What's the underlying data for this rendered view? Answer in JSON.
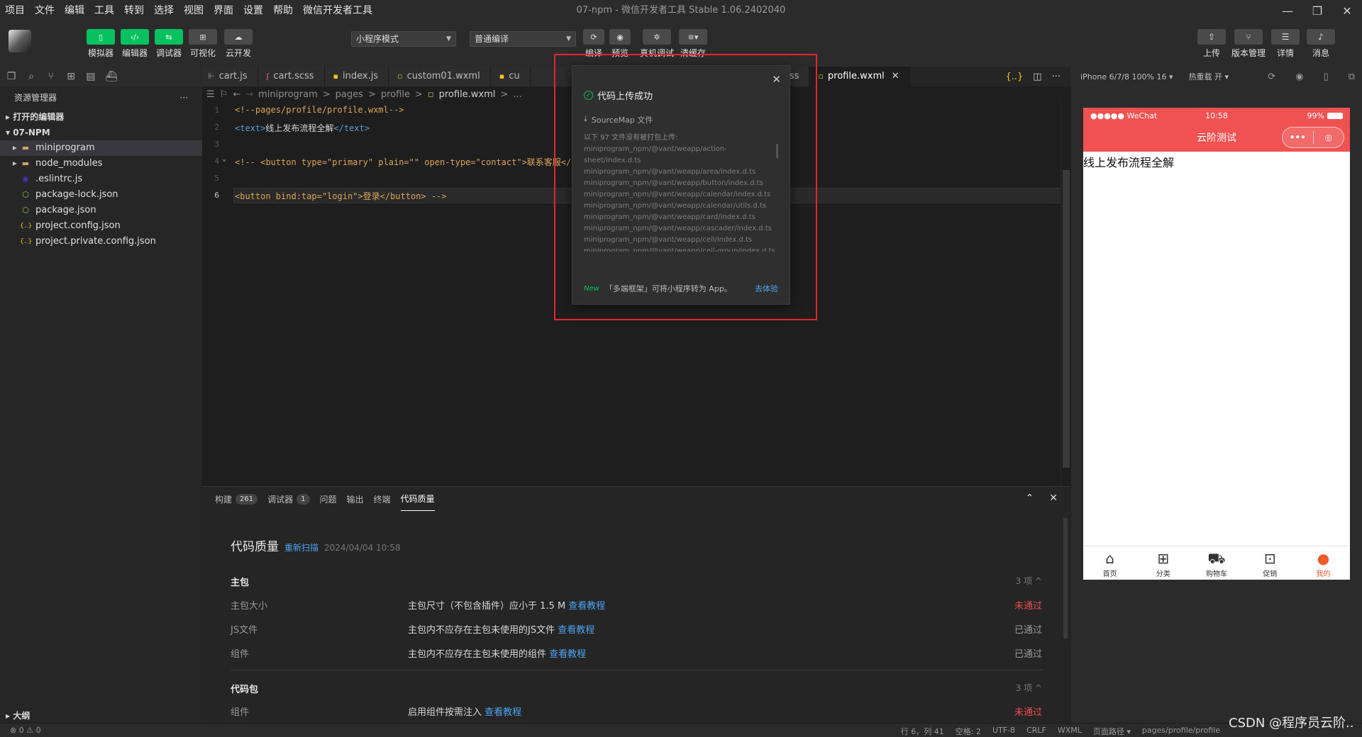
{
  "menu": [
    "项目",
    "文件",
    "编辑",
    "工具",
    "转到",
    "选择",
    "视图",
    "界面",
    "设置",
    "帮助",
    "微信开发者工具"
  ],
  "window_title": "07-npm - 微信开发者工具 Stable 1.06.2402040",
  "toolbar": {
    "simulator": "模拟器",
    "editor": "编辑器",
    "debugger": "调试器",
    "visual": "可视化",
    "cloud": "云开发",
    "mode_select": "小程序模式",
    "compile_select": "普通编译",
    "compile": "编译",
    "preview": "预览",
    "real_debug": "真机调试",
    "clear_cache": "清缓存",
    "upload": "上传",
    "version": "版本管理",
    "details": "详情",
    "messages": "消息"
  },
  "explorer": {
    "title": "资源管理器",
    "open_editors": "打开的编辑器",
    "project": "07-NPM",
    "items": [
      {
        "name": "miniprogram",
        "icon": "folder-icon",
        "expand": "▶"
      },
      {
        "name": "node_modules",
        "icon": "folder-icon",
        "expand": "▶"
      },
      {
        "name": ".eslintrc.js",
        "icon": "eslint-icon",
        "expand": ""
      },
      {
        "name": "package-lock.json",
        "icon": "npm-icon",
        "expand": ""
      },
      {
        "name": "package.json",
        "icon": "npm-icon",
        "expand": ""
      },
      {
        "name": "project.config.json",
        "icon": "json-icon",
        "expand": ""
      },
      {
        "name": "project.private.config.json",
        "icon": "json-icon",
        "expand": ""
      }
    ],
    "outline": "大纲"
  },
  "tabs": [
    {
      "label": "cart.js",
      "icon": "js-icon"
    },
    {
      "label": "cart.scss",
      "icon": "scss-icon"
    },
    {
      "label": "index.js",
      "icon": "js-icon"
    },
    {
      "label": "custom01.wxml",
      "icon": "wxml-icon"
    },
    {
      "label": "cu",
      "icon": "js-icon"
    },
    {
      "label": "s",
      "icon": "scss-icon"
    },
    {
      "label": "index.scss",
      "icon": "scss-icon"
    },
    {
      "label": "profile.wxml",
      "icon": "wxml-icon"
    }
  ],
  "breadcrumb": [
    "miniprogram",
    ">",
    "pages",
    ">",
    "profile",
    ">",
    "profile.wxml",
    ">",
    "..."
  ],
  "code": {
    "lines": [
      "1",
      "2",
      "3",
      "4",
      "5",
      "6"
    ],
    "l1": "<!--pages/profile/profile.wxml-->",
    "l2_open": "<text>",
    "l2_text": "线上发布流程全解",
    "l2_close": "</text>",
    "l4": "<!-- <button type=\"primary\" plain=\"\" open-type=\"contact\">联系客服</button>",
    "l6": "<button bind:tap=\"login\">登录</button> -->"
  },
  "popup": {
    "title": "代码上传成功",
    "sourcemap": "SourceMap 文件",
    "list_header": "以下 97 文件没有被打包上传:",
    "files": [
      "miniprogram_npm/@vant/weapp/action-",
      "sheet/index.d.ts",
      "miniprogram_npm/@vant/weapp/area/index.d.ts",
      "miniprogram_npm/@vant/weapp/button/index.d.ts",
      "miniprogram_npm/@vant/weapp/calendar/index.d.ts",
      "miniprogram_npm/@vant/weapp/calendar/utils.d.ts",
      "miniprogram_npm/@vant/weapp/card/index.d.ts",
      "miniprogram_npm/@vant/weapp/cascader/index.d.ts",
      "miniprogram_npm/@vant/weapp/cell/index.d.ts",
      "miniprogram_npm/@vant/weapp/cell-group/index.d.ts"
    ],
    "new_badge": "New",
    "footer_text": "「多端框架」可将小程序转为 App。",
    "footer_link": "去体验"
  },
  "panel": {
    "tabs": [
      {
        "label": "构建",
        "badge": "261"
      },
      {
        "label": "调试器",
        "badge": "1"
      },
      {
        "label": "问题",
        "badge": ""
      },
      {
        "label": "输出",
        "badge": ""
      },
      {
        "label": "终端",
        "badge": ""
      },
      {
        "label": "代码质量",
        "badge": ""
      }
    ],
    "heading": "代码质量",
    "rescan": "重新扫描",
    "date": "2024/04/04 10:58",
    "main_pkg": "主包",
    "main_count": "3 项 ^",
    "rows": [
      {
        "name": "主包大小",
        "desc": "主包尺寸（不包含插件）应小于 1.5 M",
        "link": "查看教程",
        "status": "未通过",
        "fail": true
      },
      {
        "name": "JS文件",
        "desc": "主包内不应存在主包未使用的JS文件",
        "link": "查看教程",
        "status": "已通过",
        "fail": false
      },
      {
        "name": "组件",
        "desc": "主包内不应存在主包未使用的组件",
        "link": "查看教程",
        "status": "已通过",
        "fail": false
      }
    ],
    "code_pkg": "代码包",
    "code_count": "3 项 ^",
    "row4": {
      "name": "组件",
      "desc": "启用组件按需注入",
      "link": "查看教程",
      "status": "未通过"
    }
  },
  "simulator": {
    "device": "iPhone 6/7/8 100% 16 ▾",
    "hot_reload": "热重载 开 ▾",
    "status_left": "●●●●● WeChat",
    "status_time": "10:58",
    "status_batt": "99%",
    "nav_title": "云阶测试",
    "content": "线上发布流程全解",
    "tabbar": [
      {
        "label": "首页",
        "icon": "⌂"
      },
      {
        "label": "分类",
        "icon": "⊞"
      },
      {
        "label": "购物车",
        "icon": "⛟"
      },
      {
        "label": "促销",
        "icon": "⊡"
      },
      {
        "label": "我的",
        "icon": "●"
      }
    ]
  },
  "statusbar": {
    "left": "⊗ 0 ⚠ 0",
    "pos": "行 6，列 41",
    "spaces": "空格: 2",
    "enc": "UTF-8",
    "eol": "CRLF",
    "lang": "WXML",
    "page_path": "页面路径 ▾",
    "path": "pages/profile/profile"
  },
  "watermark": "CSDN @程序员云阶.."
}
